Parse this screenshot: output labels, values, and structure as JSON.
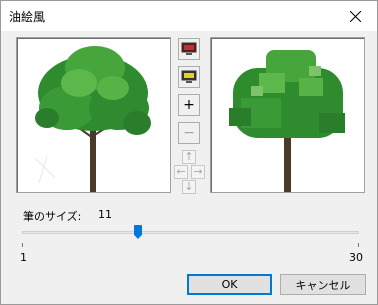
{
  "window": {
    "title": "油絵風"
  },
  "tools": {
    "zoom_in_label": "+",
    "zoom_out_label": "−",
    "arrows": {
      "up": "↑",
      "left": "←",
      "right": "→",
      "down": "↓"
    }
  },
  "brush": {
    "label": "筆のサイズ:",
    "value": "11",
    "min_label": "1",
    "max_label": "30",
    "min": 1,
    "max": 30,
    "current": 11
  },
  "buttons": {
    "ok": "OK",
    "cancel": "キャンセル"
  },
  "colors": {
    "accent": "#0078d7",
    "tree_green": "#2e8b2e",
    "trunk": "#4a3a2a"
  }
}
